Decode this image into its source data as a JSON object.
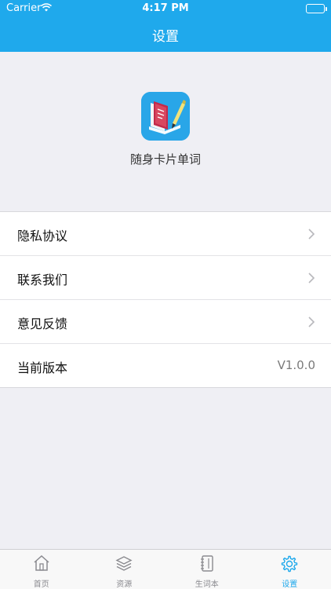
{
  "status_bar": {
    "carrier": "Carrier",
    "time": "4:17 PM"
  },
  "nav": {
    "title": "设置"
  },
  "app": {
    "name": "随身卡片单词",
    "icon": "book-pen-app-icon"
  },
  "settings": {
    "items": [
      {
        "label": "隐私协议",
        "icon": "chevron-right-icon"
      },
      {
        "label": "联系我们",
        "icon": "chevron-right-icon"
      },
      {
        "label": "意见反馈",
        "icon": "chevron-right-icon"
      },
      {
        "label": "当前版本",
        "value": "V1.0.0"
      }
    ]
  },
  "tabbar": {
    "tabs": [
      {
        "label": "首页",
        "icon": "home-icon"
      },
      {
        "label": "资源",
        "icon": "layers-icon"
      },
      {
        "label": "生词本",
        "icon": "notebook-icon"
      },
      {
        "label": "设置",
        "icon": "gear-icon",
        "active": true
      }
    ]
  },
  "colors": {
    "accent": "#1fa9ec",
    "background": "#efeff4"
  }
}
